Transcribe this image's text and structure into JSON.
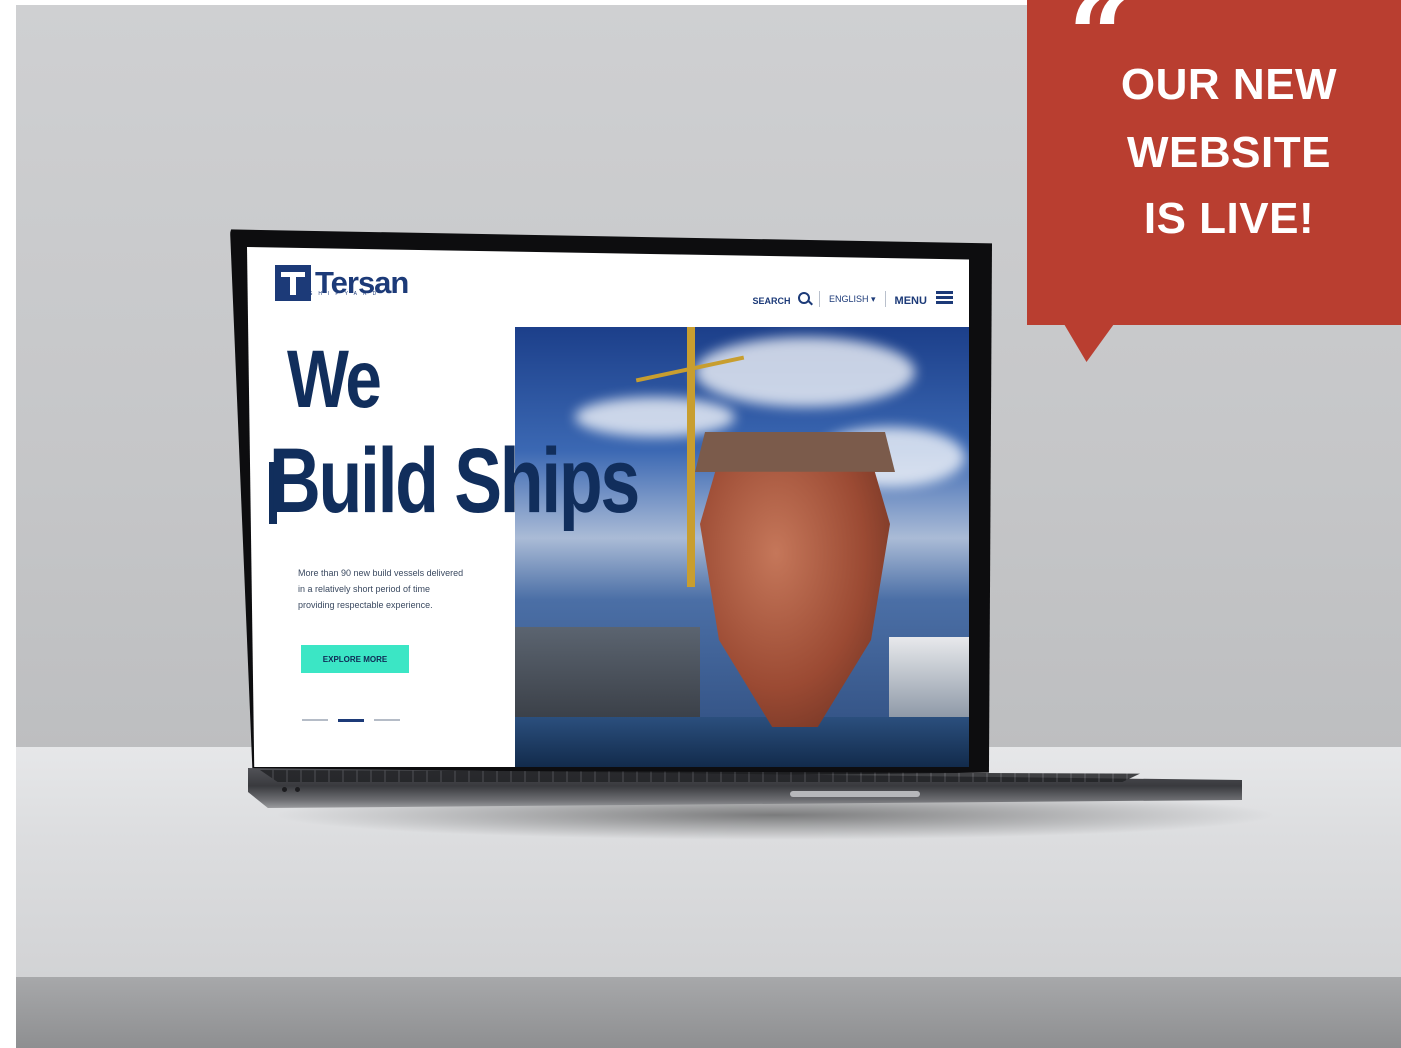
{
  "website": {
    "logo_text": "Tersan",
    "logo_subtext": "SHIPYARD",
    "nav": {
      "search_label": "SEARCH",
      "language_label": "ENGLISH",
      "menu_label": "MENU"
    },
    "hero": {
      "headline_line1": "We",
      "headline_line2": "Build Ships",
      "description": "More than 90 new build vessels delivered in a relatively short period of time providing respectable experience.",
      "cta_label": "EXPLORE MORE"
    },
    "colors": {
      "brand_navy": "#112e5c",
      "cta_teal": "#3be6c5"
    }
  },
  "callout": {
    "lines": [
      "OUR NEW",
      "WEBSITE",
      "IS LIVE!"
    ],
    "quote_glyph": "“",
    "color": "#b93e30"
  }
}
